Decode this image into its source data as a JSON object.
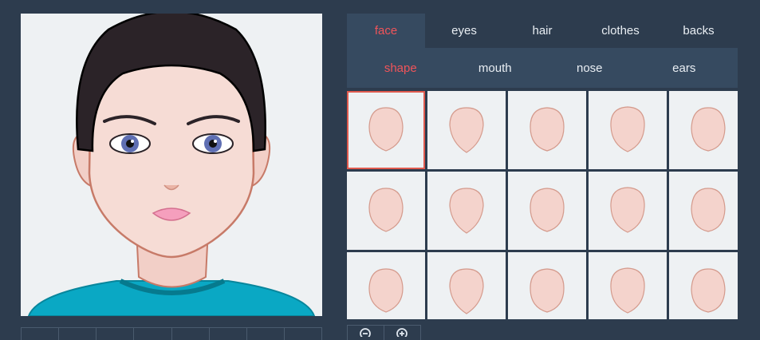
{
  "tabs": [
    {
      "label": "face",
      "active": true
    },
    {
      "label": "eyes",
      "active": false
    },
    {
      "label": "hair",
      "active": false
    },
    {
      "label": "clothes",
      "active": false
    },
    {
      "label": "backs",
      "active": false
    }
  ],
  "subtabs": [
    {
      "label": "shape",
      "active": true
    },
    {
      "label": "mouth",
      "active": false
    },
    {
      "label": "nose",
      "active": false
    },
    {
      "label": "ears",
      "active": false
    }
  ],
  "face_shapes": {
    "count": 15,
    "selected_index": 0
  },
  "zoom": {
    "zoom_out_icon": "zoom-out-icon",
    "zoom_in_icon": "zoom-in-icon"
  },
  "colors": {
    "background": "#2d3c4e",
    "panel": "#364a60",
    "active": "#f0545a",
    "skin": "#f4d3cc",
    "hair": "#2b2328",
    "shirt": "#0aa8c4"
  }
}
